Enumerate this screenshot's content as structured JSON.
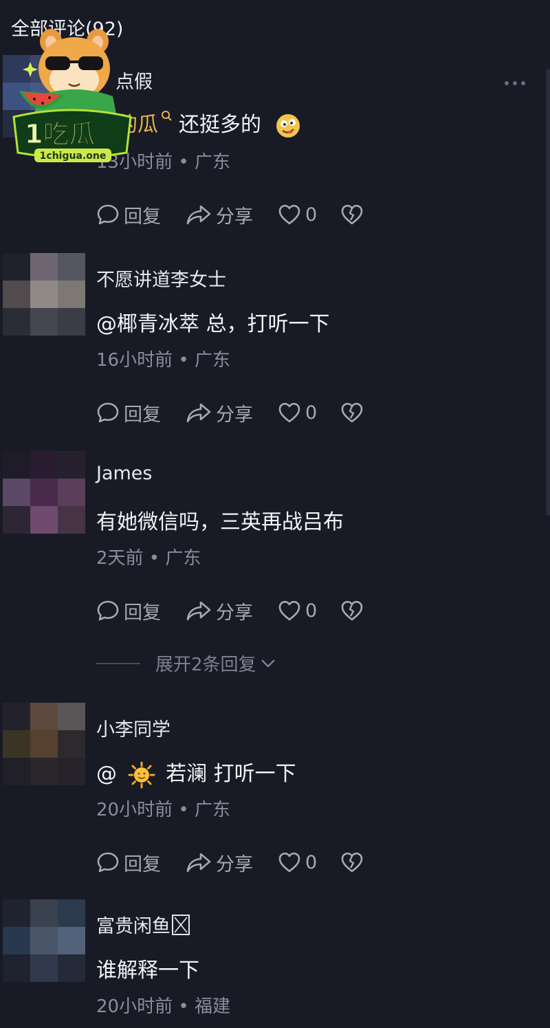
{
  "header": {
    "title": "全部评论(92)"
  },
  "comments": [
    {
      "name": "点假",
      "text_highlight": "子的瓜",
      "text_after": "还挺多的",
      "time": "13小时前",
      "location": "广东",
      "reply_label": "回复",
      "share_label": "分享",
      "likes": "0"
    },
    {
      "name": "不愿讲道李女士",
      "text": "@椰青冰萃 总，打听一下",
      "time": "16小时前",
      "location": "广东",
      "reply_label": "回复",
      "share_label": "分享",
      "likes": "0"
    },
    {
      "name": "James",
      "text": "有她微信吗，三英再战吕布",
      "time": "2天前",
      "location": "广东",
      "reply_label": "回复",
      "share_label": "分享",
      "likes": "0",
      "expand_label": "展开2条回复"
    },
    {
      "name": "小李同学",
      "text_before": "@",
      "text_after": "若澜  打听一下",
      "time": "20小时前",
      "location": "广东",
      "reply_label": "回复",
      "share_label": "分享",
      "likes": "0"
    },
    {
      "name": "富贵闲鱼",
      "text": "谁解释一下",
      "time": "20小时前",
      "location": "福建"
    }
  ],
  "logo": {
    "brand": "1吃瓜",
    "site": "1chigua.one"
  },
  "separator": " • ",
  "icons": [
    "comment-icon",
    "share-icon",
    "heart-icon",
    "broken-heart-icon",
    "more-icon",
    "chevron-down-icon",
    "search-icon",
    "sun-emoji",
    "face-emoji"
  ],
  "colors": {
    "background": "#181a25",
    "highlight": "#e8b34a",
    "meta": "#8a8e9b"
  }
}
